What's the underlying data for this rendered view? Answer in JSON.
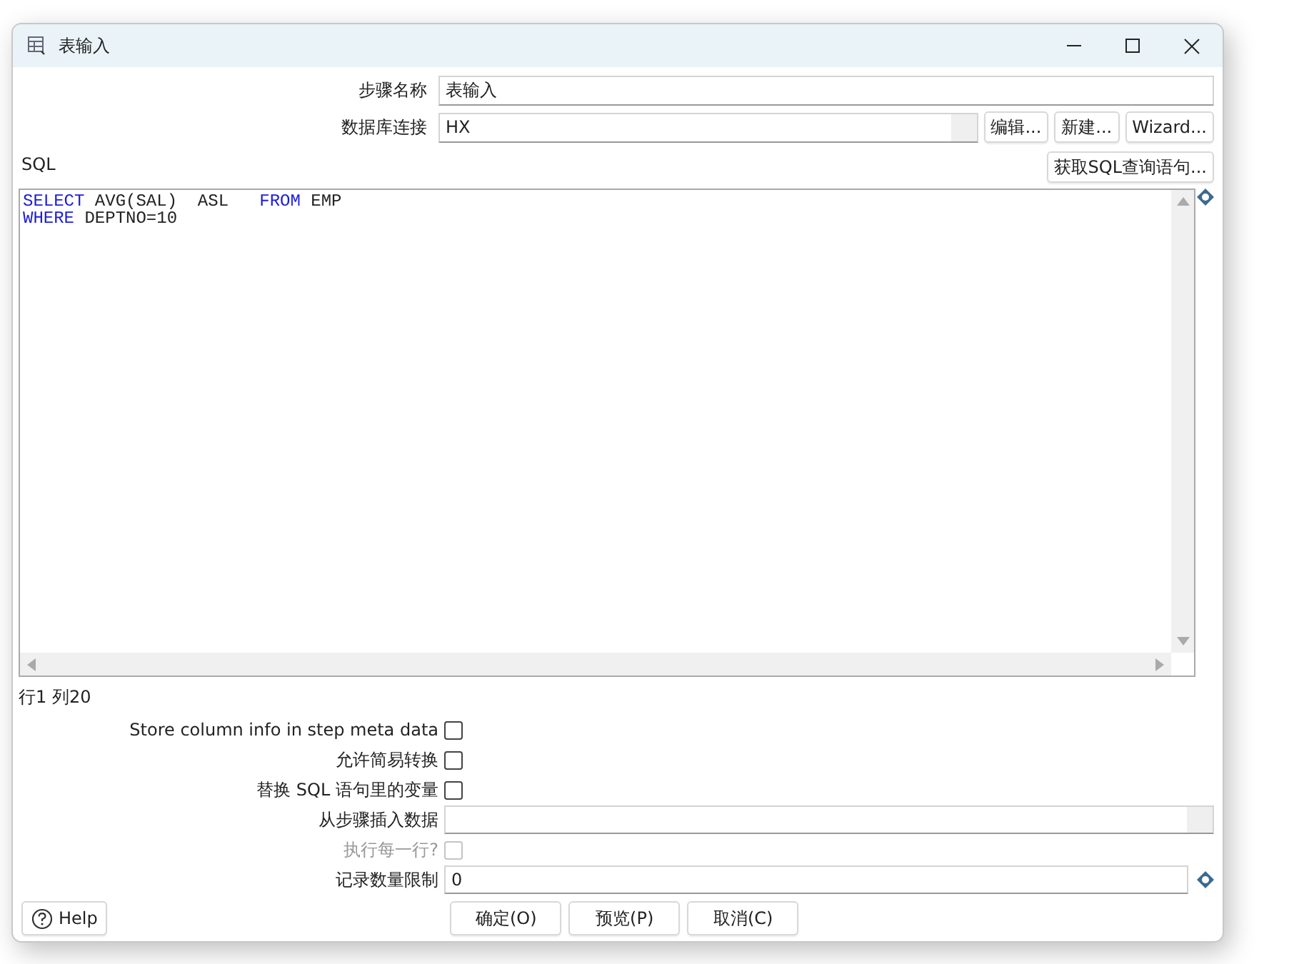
{
  "window": {
    "title": "表输入"
  },
  "step_name": {
    "label": "步骤名称",
    "value": "表输入"
  },
  "connection": {
    "label": "数据库连接",
    "value": "HX",
    "buttons": [
      "编辑...",
      "新建...",
      "Wizard..."
    ]
  },
  "sql": {
    "label": "SQL",
    "get_button": "获取SQL查询语句...",
    "lines": [
      [
        {
          "text": "SELECT",
          "kind": "keyword"
        },
        {
          "text": " AVG(SAL)  ASL   ",
          "kind": "plain"
        },
        {
          "text": "FROM",
          "kind": "keyword"
        },
        {
          "text": " EMP",
          "kind": "plain"
        }
      ],
      [
        {
          "text": "WHERE",
          "kind": "keyword"
        },
        {
          "text": " DEPTNO=10",
          "kind": "plain"
        }
      ]
    ]
  },
  "cursor_position": "行1 列20",
  "options": [
    {
      "kind": "checkbox",
      "label": "Store column info in step meta data",
      "checked": false,
      "disabled": false
    },
    {
      "kind": "checkbox",
      "label": "允许简易转换",
      "checked": false,
      "disabled": false
    },
    {
      "kind": "checkbox",
      "label": "替换 SQL 语句里的变量",
      "checked": false,
      "disabled": false
    },
    {
      "kind": "dropdown",
      "label": "从步骤插入数据"
    },
    {
      "kind": "checkbox",
      "label": "执行每一行?",
      "checked": false,
      "disabled": true
    },
    {
      "kind": "variable_field",
      "label": "记录数量限制",
      "value": "0"
    }
  ],
  "help_button": "Help",
  "buttons": [
    "确定(O)",
    "预览(P)",
    "取消(C)"
  ]
}
